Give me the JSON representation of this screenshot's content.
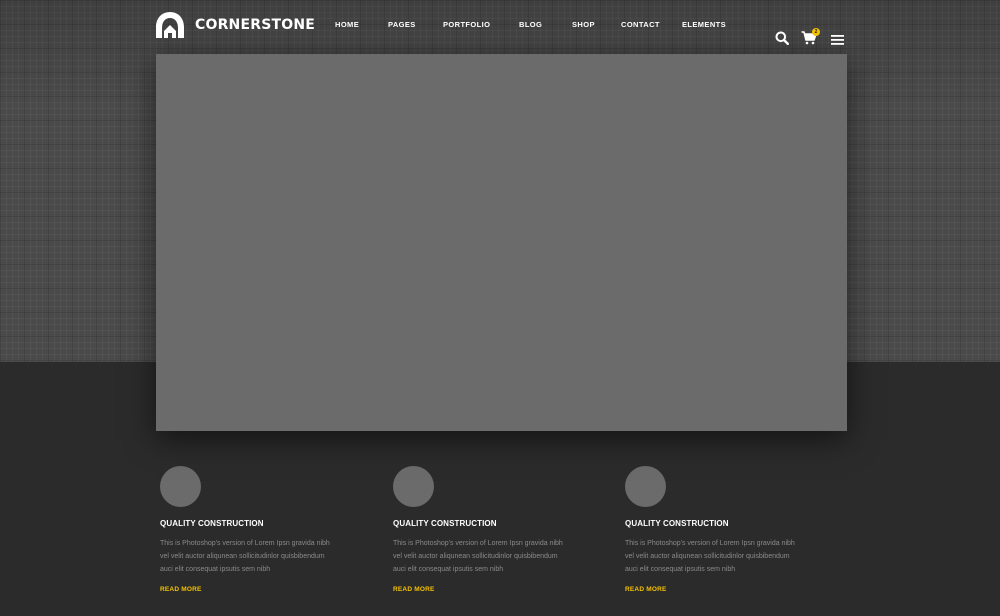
{
  "brand": {
    "name": "CORNERSTONE",
    "logo_icon": "house-arch-logo"
  },
  "nav": {
    "items": [
      {
        "label": "HOME"
      },
      {
        "label": "PAGES"
      },
      {
        "label": "PORTFOLIO"
      },
      {
        "label": "BLOG"
      },
      {
        "label": "SHOP"
      },
      {
        "label": "CONTACT"
      },
      {
        "label": "ELEMENTS"
      }
    ]
  },
  "header_icons": {
    "search": "search-icon",
    "cart": "cart-icon",
    "cart_count": "2",
    "menu": "hamburger-menu-icon"
  },
  "colors": {
    "accent": "#f5c200",
    "hero_bg": "#4a4a4a",
    "page_bg": "#2b2b2b",
    "placeholder": "#6b6b6b"
  },
  "features": [
    {
      "title": "QUALITY CONSTRUCTION",
      "desc_line1": "This is Photoshop's version  of Lorem Ipsn gravida nibh",
      "desc_line2": "vel velit auctor aliqunean sollicitudinlor quisbibendum",
      "desc_line3": "auci elit consequat ipsutis sem nibh",
      "link": "READ MORE"
    },
    {
      "title": "QUALITY CONSTRUCTION",
      "desc_line1": "This is Photoshop's version  of Lorem Ipsn gravida nibh",
      "desc_line2": "vel velit auctor aliqunean sollicitudinlor quisbibendum",
      "desc_line3": "auci elit consequat ipsutis sem nibh",
      "link": "READ MORE"
    },
    {
      "title": "QUALITY CONSTRUCTION",
      "desc_line1": "This is Photoshop's version  of Lorem Ipsn gravida nibh",
      "desc_line2": "vel velit auctor aliqunean sollicitudinlor quisbibendum",
      "desc_line3": "auci elit consequat ipsutis sem nibh",
      "link": "READ MORE"
    }
  ]
}
